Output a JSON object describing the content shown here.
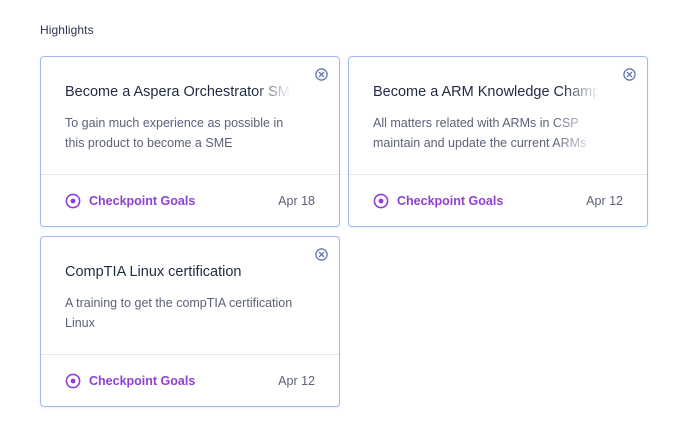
{
  "section": {
    "title": "Highlights"
  },
  "colors": {
    "accent": "#8f3fd6",
    "card_border": "#9fb8f2",
    "close_icon": "#5a6fa8"
  },
  "cards": [
    {
      "title": "Become a Aspera Orchestrator SME",
      "desc_line1": "To gain much experience as possible in",
      "desc_line2": "this product to become a SME",
      "goal_label": "Checkpoint Goals",
      "goal_icon": "target-circle-icon",
      "date": "Apr 18"
    },
    {
      "title": "Become a ARM Knowledge Champion",
      "desc_line1": "All matters related with ARMs in CSP",
      "desc_line2": "maintain and update the current ARMs",
      "goal_label": "Checkpoint Goals",
      "goal_icon": "target-circle-icon",
      "date": "Apr 12"
    },
    {
      "title": "CompTIA Linux certification",
      "desc_line1": "A training to get the compTIA certification",
      "desc_line2": "Linux",
      "goal_label": "Checkpoint Goals",
      "goal_icon": "target-circle-icon",
      "date": "Apr 12"
    }
  ]
}
